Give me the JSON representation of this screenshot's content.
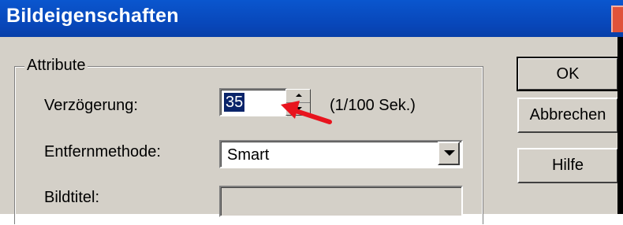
{
  "window": {
    "title": "Bildeigenschaften"
  },
  "group": {
    "legend": "Attribute"
  },
  "fields": {
    "delay": {
      "label": "Verzögerung:",
      "value": "35",
      "unit": "(1/100 Sek.)"
    },
    "removal_method": {
      "label": "Entfernmethode:",
      "value": "Smart"
    },
    "image_title": {
      "label": "Bildtitel:",
      "value": ""
    }
  },
  "buttons": {
    "ok": "OK",
    "cancel": "Abbrechen",
    "help": "Hilfe"
  },
  "annotation": {
    "color": "#e8141e"
  },
  "colors": {
    "titlebar": "#0846b8",
    "selection": "#0a246a",
    "face": "#d4d0c8"
  }
}
